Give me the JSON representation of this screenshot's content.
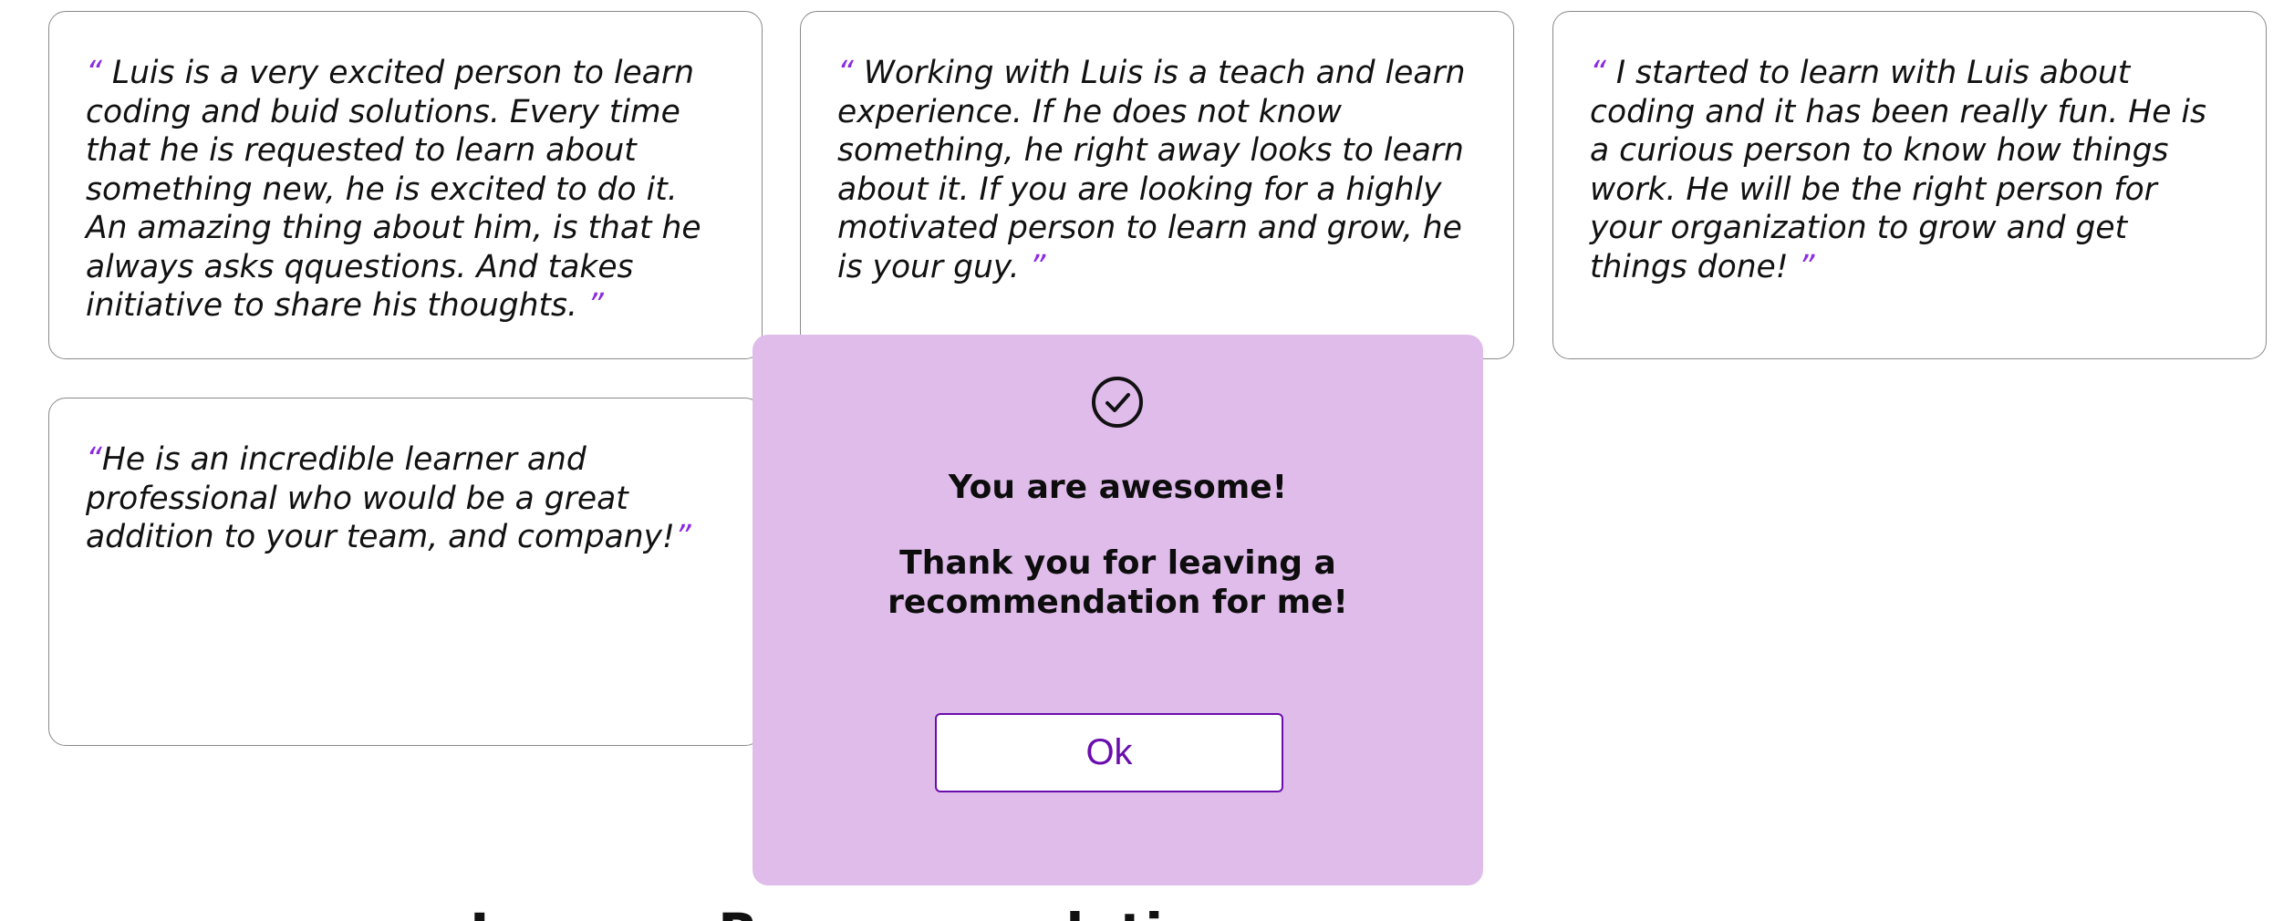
{
  "recommendations": [
    {
      "open_quote": "“",
      "text": " Luis is a very excited person to learn coding and buid solutions. Every time that he is requested to learn about something new, he is excited to do it. An amazing thing about him, is that he always asks qquestions. And takes initiative to share his thoughts. ",
      "close_quote": "”"
    },
    {
      "open_quote": "“",
      "text": " Working with Luis is a teach and learn experience. If he does not know something, he right away looks to learn about it. If you are looking for a highly motivated person to learn and grow, he is your guy. ",
      "close_quote": "”"
    },
    {
      "open_quote": "“",
      "text": " I started to learn with Luis about coding and it has been really fun. He is a curious person to know how things work. He will be the right person for your organization to grow and get things done! ",
      "close_quote": "”"
    },
    {
      "open_quote": "“",
      "text": "He is an incredible learner and professional who would be a great addition to your team, and company!",
      "close_quote": "”"
    }
  ],
  "section_heading": "Leave a Recommendation",
  "modal": {
    "icon": "check-circle-icon",
    "title": "You are awesome!",
    "message": "Thank you for leaving a recommendation for me!",
    "ok_label": "Ok",
    "background": "#e0bceb",
    "accent": "#6a0dad"
  },
  "colors": {
    "quote_mark": "#8a2be2",
    "card_border": "#8a8a8a"
  }
}
